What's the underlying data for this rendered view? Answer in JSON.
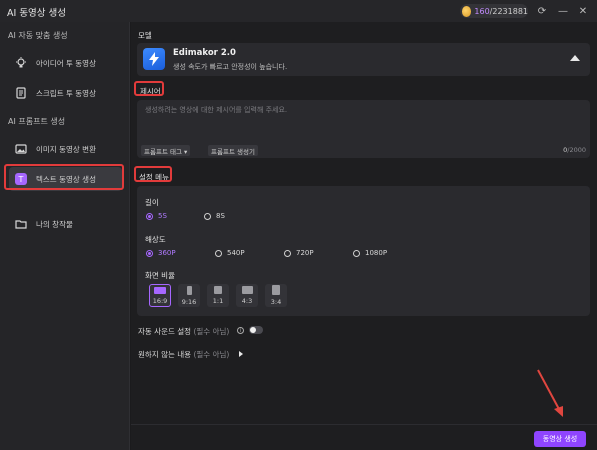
{
  "window": {
    "title": "AI 동영상 생성",
    "credits_used": "160",
    "credits_total": "/2231881"
  },
  "sidebar": {
    "section_ai_custom": "AI 자동 맞춤 생성",
    "section_ai_prompt": "AI 프롬프트 생성",
    "items": [
      {
        "label": "아이디어 투 동영상",
        "icon": "bulb-icon"
      },
      {
        "label": "스크립트 투 동영상",
        "icon": "document-icon"
      },
      {
        "label": "이미지 동영상 변환",
        "icon": "image-icon"
      },
      {
        "label": "텍스트 동영상 생성",
        "icon": "text-t-icon"
      },
      {
        "label": "나의 창작물",
        "icon": "folder-icon"
      }
    ]
  },
  "model": {
    "label": "모델",
    "name": "Edimakor 2.0",
    "description": "생성 속도가 빠르고 안정성이 높습니다."
  },
  "prompt": {
    "label": "제시어",
    "placeholder": "생성하려는 영상에 대한 제시어를 입력해 주세요.",
    "tag_button": "프롬프트 태그 ▾",
    "generator_button": "프롬프트 생성기",
    "count_current": "0",
    "count_max": "/2000"
  },
  "settings": {
    "label": "설정 메뉴",
    "length_label": "길이",
    "length_options": [
      "5S",
      "8S"
    ],
    "length_selected": "5S",
    "resolution_label": "해상도",
    "resolution_options": [
      "360P",
      "540P",
      "720P",
      "1080P"
    ],
    "resolution_selected": "360P",
    "ratio_label": "화면 비율",
    "ratio_options": [
      "16:9",
      "9:16",
      "1:1",
      "4:3",
      "3:4"
    ],
    "ratio_selected": "16:9"
  },
  "auto_sound": {
    "label": "자동 사운드 설정",
    "hint": "(필수 아님)",
    "enabled": false
  },
  "negative": {
    "label": "원하지 않는 내용",
    "hint": "(필수 아님)"
  },
  "footer": {
    "generate_button": "동영상 생성"
  },
  "colors": {
    "accent": "#a667ff",
    "button": "#8f45ff",
    "highlight_box": "#e23b3b",
    "arrow": "#e0463f"
  }
}
